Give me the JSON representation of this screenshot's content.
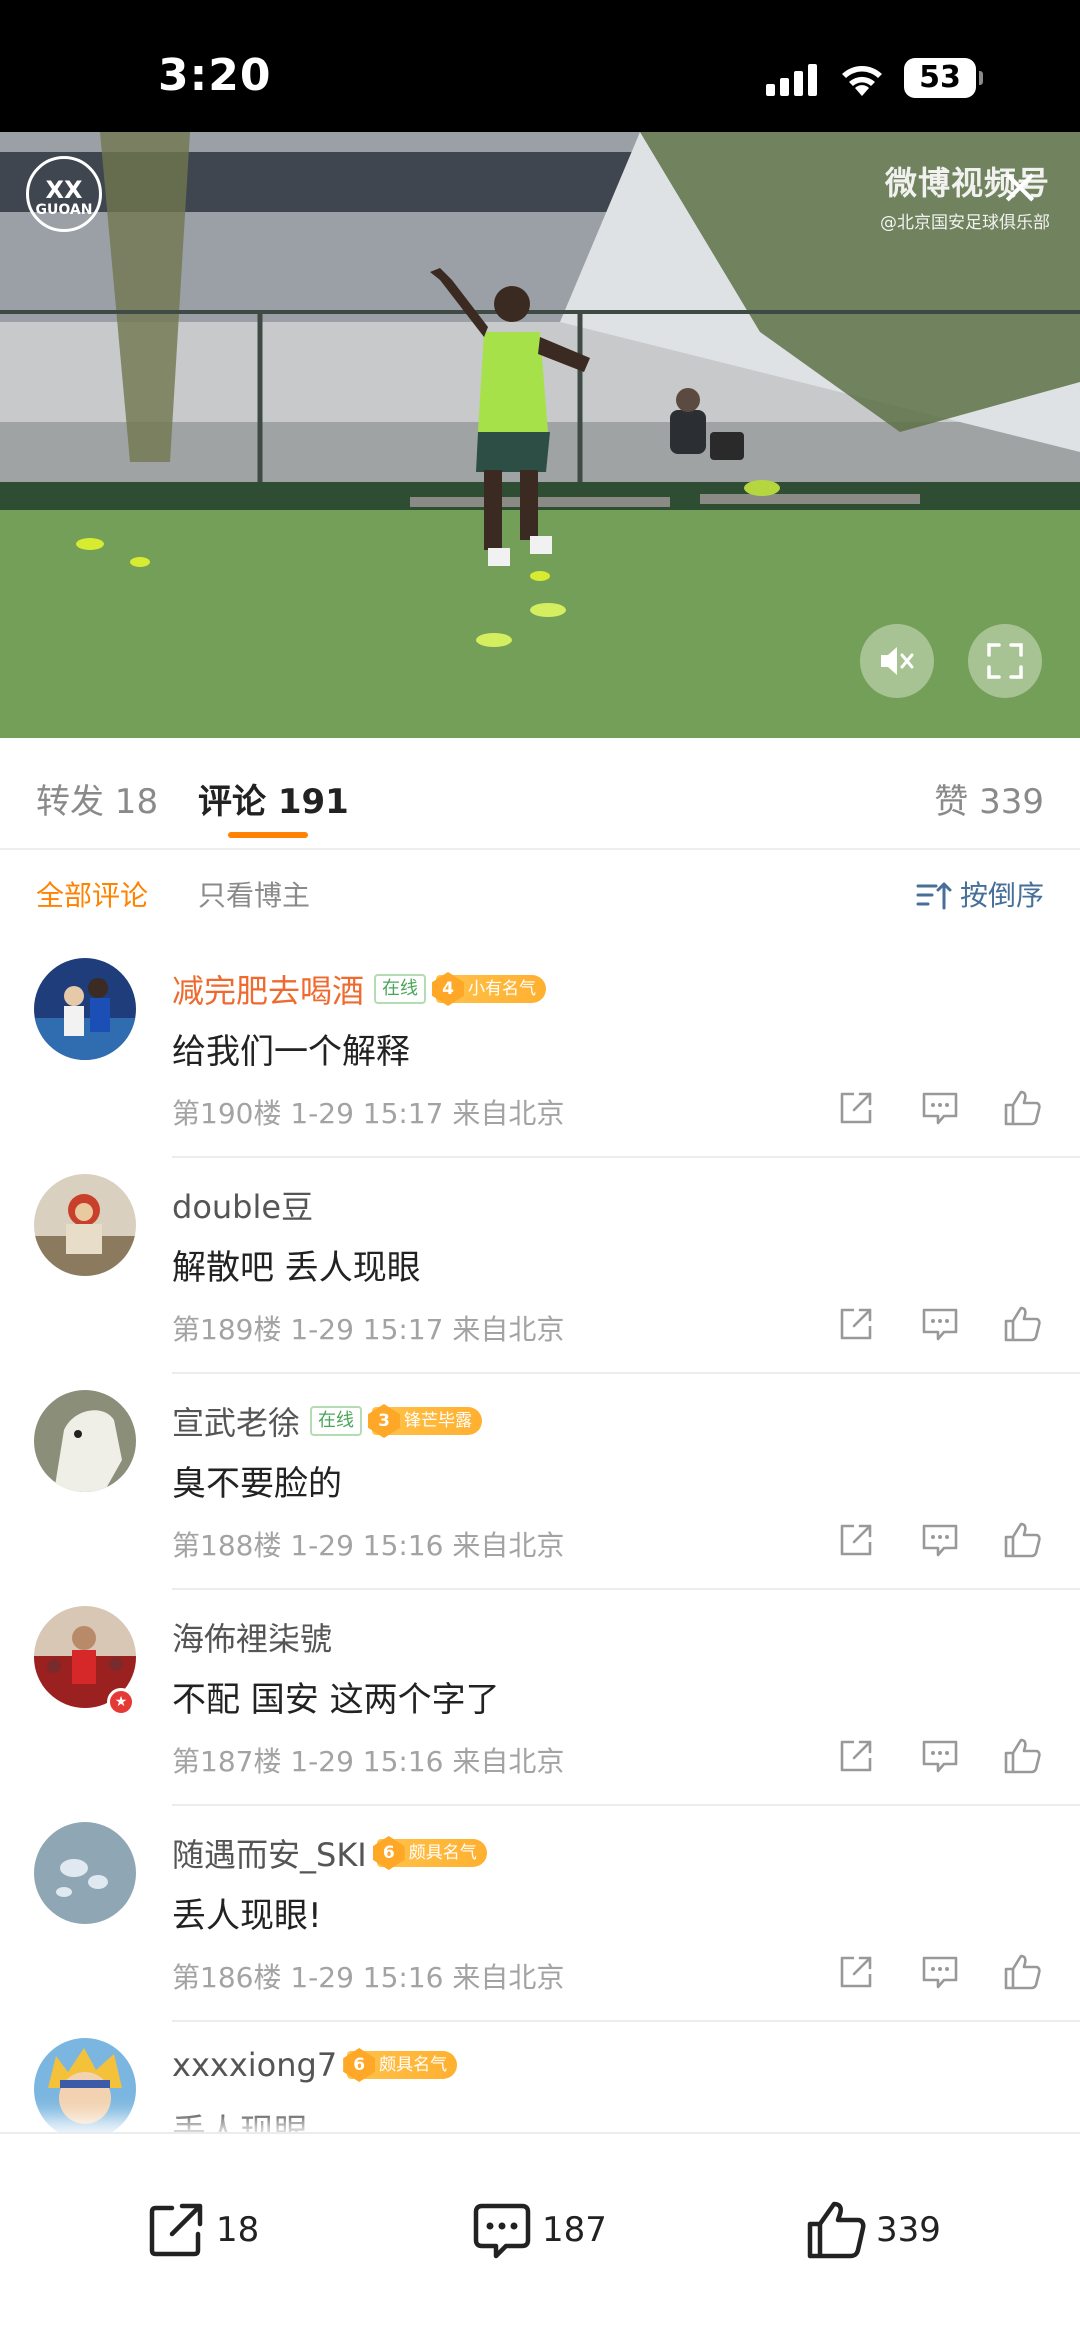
{
  "status_bar": {
    "time": "3:20",
    "battery": "53"
  },
  "video": {
    "club_logo": {
      "top": "XX",
      "bottom": "GUOAN"
    },
    "watermark": {
      "title": "微博视频号",
      "subtitle": "@北京国安足球俱乐部"
    },
    "mute_icon": "speaker-mute-icon",
    "fullscreen_icon": "fullscreen-icon"
  },
  "tabs": {
    "repost": "转发 18",
    "comments": "评论 191",
    "like": "赞 339"
  },
  "filters": {
    "all": "全部评论",
    "host_only": "只看博主",
    "sort": "按倒序"
  },
  "comments": [
    {
      "username": "减完肥去喝酒",
      "online": "在线",
      "level": "4",
      "badge": "小有名气",
      "text": "给我们一个解释",
      "meta": "第190楼 1-29 15:17 来自北京"
    },
    {
      "username": "double豆",
      "text": "解散吧 丢人现眼",
      "meta": "第189楼 1-29 15:17 来自北京"
    },
    {
      "username": "宣武老徐",
      "online": "在线",
      "level": "3",
      "badge": "锋芒毕露",
      "text": "臭不要脸的",
      "meta": "第188楼 1-29 15:16 来自北京"
    },
    {
      "username": "海佈裡柒號",
      "text": "不配 国安 这两个字了",
      "meta": "第187楼 1-29 15:16 来自北京"
    },
    {
      "username": "随遇而安_SKI",
      "level": "6",
      "badge": "颇具名气",
      "text": "丢人现眼!",
      "meta": "第186楼 1-29 15:16 来自北京"
    },
    {
      "username": "xxxxiong7",
      "level": "6",
      "badge": "颇具名气",
      "text": "丢人现眼"
    }
  ],
  "bottom_bar": {
    "share_count": "18",
    "comment_count": "187",
    "like_count": "339"
  },
  "colors": {
    "accent": "#ff8200",
    "link_blue": "#476f9a",
    "badge_gold": "#ffb02f",
    "online_green": "#4aa55a"
  }
}
